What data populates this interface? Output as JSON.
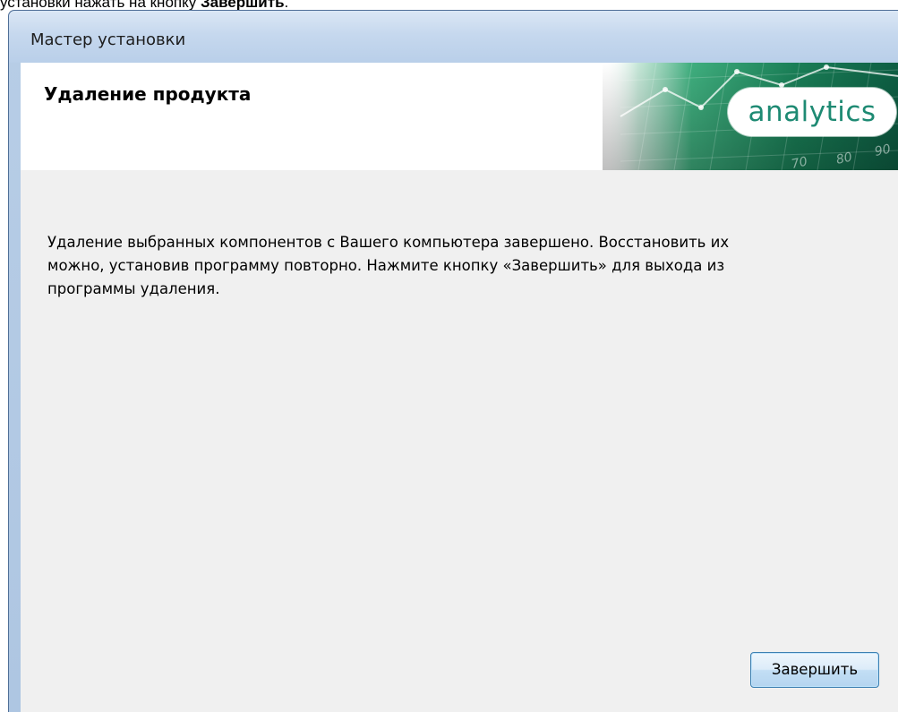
{
  "document_snippet": {
    "text_before": "установки нажать на кнопку ",
    "bold_word": "Завершить",
    "text_after": "."
  },
  "window": {
    "title": "Мастер установки"
  },
  "header": {
    "title": "Удаление продукта",
    "logo_text": "analytics",
    "banner_numbers": [
      "70",
      "80",
      "90"
    ]
  },
  "main": {
    "message_lines": [
      "Удаление выбранных компонентов с Вашего компьютера завершено. Восстановить их",
      "можно, установив программу повторно. Нажмите кнопку «Завершить» для выхода из",
      "программы удаления."
    ]
  },
  "buttons": {
    "finish_label": "Завершить"
  },
  "colors": {
    "logo_text": "#1e8a73",
    "banner_dark": "#0d5e43",
    "banner_light": "#3fae7e",
    "client_bg": "#f0f0f0",
    "titlebar": "#c6d8ee"
  },
  "icons": {
    "banner": "chart-banner-graphic"
  }
}
